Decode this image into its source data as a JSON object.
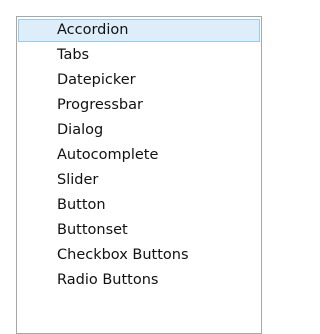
{
  "list": {
    "selected_index": 0,
    "items": [
      {
        "label": "Accordion"
      },
      {
        "label": "Tabs"
      },
      {
        "label": "Datepicker"
      },
      {
        "label": "Progressbar"
      },
      {
        "label": "Dialog"
      },
      {
        "label": "Autocomplete"
      },
      {
        "label": "Slider"
      },
      {
        "label": "Button"
      },
      {
        "label": "Buttonset"
      },
      {
        "label": "Checkbox Buttons"
      },
      {
        "label": "Radio Buttons"
      }
    ]
  }
}
